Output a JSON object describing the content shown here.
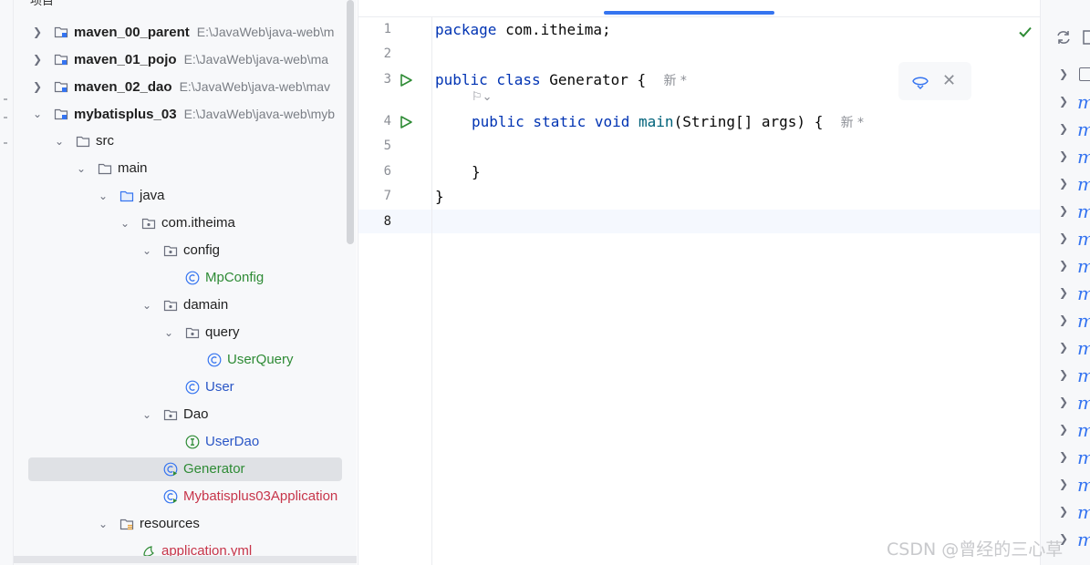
{
  "project_panel": {
    "header_label": "项目",
    "tree": [
      {
        "label": "maven_00_parent",
        "path": "E:\\JavaWeb\\java-web\\m",
        "type": "module"
      },
      {
        "label": "maven_01_pojo",
        "path": "E:\\JavaWeb\\java-web\\ma",
        "type": "module"
      },
      {
        "label": "maven_02_dao",
        "path": "E:\\JavaWeb\\java-web\\mav",
        "type": "module"
      },
      {
        "label": "mybatisplus_03",
        "path": "E:\\JavaWeb\\java-web\\myb",
        "type": "module"
      },
      {
        "label": "src",
        "type": "folder"
      },
      {
        "label": "main",
        "type": "folder"
      },
      {
        "label": "java",
        "type": "source-folder"
      },
      {
        "label": "com.itheima",
        "type": "package"
      },
      {
        "label": "config",
        "type": "package"
      },
      {
        "label": "MpConfig",
        "type": "class"
      },
      {
        "label": "damain",
        "type": "package"
      },
      {
        "label": "query",
        "type": "package"
      },
      {
        "label": "UserQuery",
        "type": "class"
      },
      {
        "label": "User",
        "type": "class"
      },
      {
        "label": "Dao",
        "type": "package"
      },
      {
        "label": "UserDao",
        "type": "interface"
      },
      {
        "label": "Generator",
        "type": "runnable-class"
      },
      {
        "label": "Mybatisplus03Application",
        "type": "runnable-class"
      },
      {
        "label": "resources",
        "type": "resources-folder"
      },
      {
        "label": "application.yml",
        "type": "yaml"
      }
    ]
  },
  "editor": {
    "line_numbers": [
      "1",
      "2",
      "3",
      "4",
      "5",
      "6",
      "7",
      "8"
    ],
    "code": {
      "line1_kw": "package",
      "line1_rest": " com.itheima;",
      "line3_kw": "public class",
      "line3_rest": " Generator {",
      "line3_hint": "新 *",
      "inlay_hint": "⚐⌄",
      "line4_kw": "public static void",
      "line4_fn": " main",
      "line4_rest": "(String[] args) {",
      "line4_hint": "新 *",
      "line6": "}",
      "line7": "}"
    },
    "float_toolbar": {
      "close_glyph": "✕"
    }
  },
  "right_panel": {
    "item_glyph": "m",
    "row_count": 18
  },
  "watermark": "CSDN @曾经的三心草",
  "colors": {
    "accent": "#3574f0",
    "keyword": "#0033b3",
    "class_green": "#2e8b35",
    "error_red": "#c7354a"
  }
}
